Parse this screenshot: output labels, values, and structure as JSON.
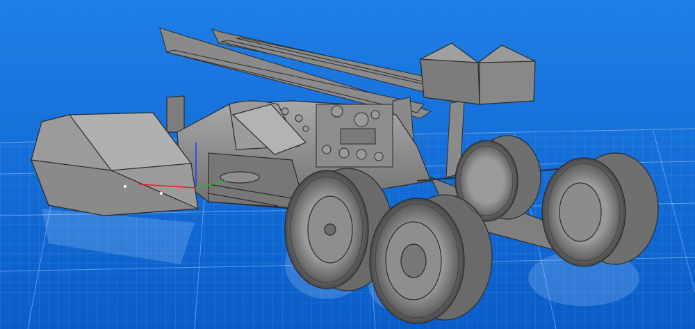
{
  "viewport": {
    "background_top": "#1f7fe6",
    "background_bottom": "#0a5cc7",
    "grid_color": "#6fb3ff",
    "grid_major_color": "#a9d3ff"
  },
  "model": {
    "body_color": "#8a8a8a",
    "body_light": "#a9a9a9",
    "body_dark": "#5d5d5d",
    "edge_color": "#2b2b2b",
    "tire_color": "#6f6f6f",
    "tire_dark": "#4a4a4a"
  },
  "gizmo": {
    "x_axis_color": "#e0242a",
    "y_axis_color": "#1fbf2c",
    "z_axis_color": "#2b3cf0"
  }
}
